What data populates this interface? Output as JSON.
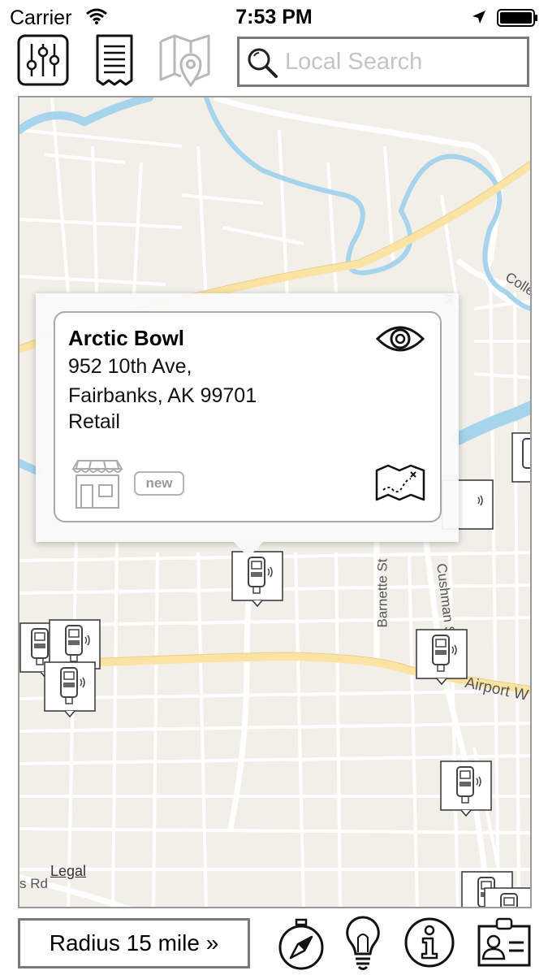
{
  "status_bar": {
    "carrier": "Carrier",
    "time": "7:53 PM"
  },
  "toolbar": {
    "icons": [
      "sliders-icon",
      "receipt-icon",
      "map-pin-icon"
    ],
    "search": {
      "placeholder": "Local Search",
      "value": ""
    }
  },
  "map": {
    "legal_label": "Legal",
    "road_labels": [
      "Colle",
      "Barnette St",
      "Cushman St",
      "Airport W",
      "s Rd",
      "S",
      "st"
    ],
    "callout": {
      "name": "Arctic Bowl",
      "address_line1": "952 10th Ave,",
      "address_line2": "Fairbanks, AK 99701",
      "category": "Retail",
      "badge": "new"
    }
  },
  "bottom_bar": {
    "radius_label": "Radius 15 mile »",
    "icons": [
      "compass-icon",
      "lightbulb-icon",
      "info-icon",
      "id-card-icon"
    ]
  },
  "colors": {
    "map_bg": "#f2efe8",
    "water": "#a5d4ec",
    "major_road": "#fbe3a3",
    "minor_road": "#ffffff",
    "border": "#7a7a7a"
  }
}
